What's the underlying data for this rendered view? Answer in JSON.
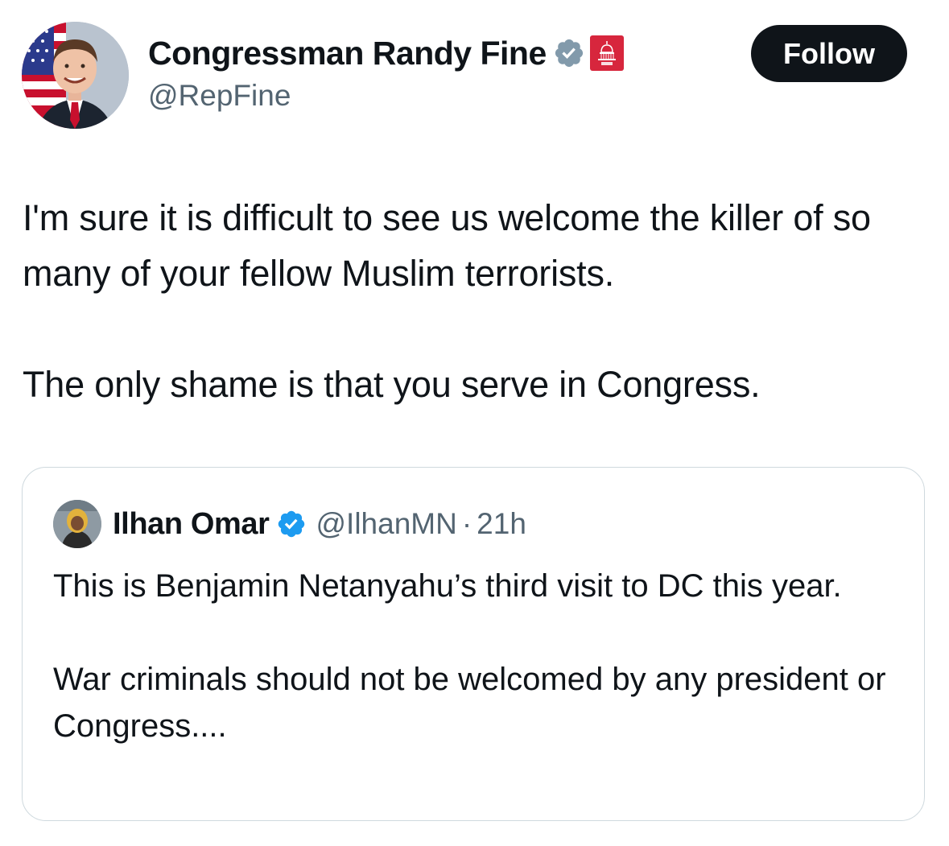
{
  "author": {
    "display_name": "Congressman Randy Fine",
    "handle": "@RepFine",
    "verified_badge": "gray-verified-checkmark-icon",
    "affiliation_badge": "house-gop-capitol-icon",
    "avatar": "portrait-with-american-flag"
  },
  "follow_button": {
    "label": "Follow"
  },
  "tweet": {
    "paragraph_1": "I'm sure it is difficult to see us welcome the killer of so many of your fellow Muslim terrorists.",
    "paragraph_2": "The only shame is that you serve in Congress."
  },
  "quoted_tweet": {
    "display_name": "Ilhan Omar",
    "handle": "@IlhanMN",
    "separator": "·",
    "time": "21h",
    "verified_badge": "blue-verified-checkmark-icon",
    "avatar": "portrait-with-yellow-headscarf",
    "paragraph_1": "This is Benjamin Netanyahu’s third visit to DC this year.",
    "paragraph_2": "War criminals should not be welcomed by any president or Congress...."
  },
  "colors": {
    "text_primary": "#0f1419",
    "text_secondary": "#536471",
    "border": "#cfd9de",
    "verified_gray": "#829aab",
    "verified_blue": "#1d9bf0",
    "gop_red": "#d7263d",
    "button_bg": "#0f1419",
    "button_text": "#ffffff"
  }
}
